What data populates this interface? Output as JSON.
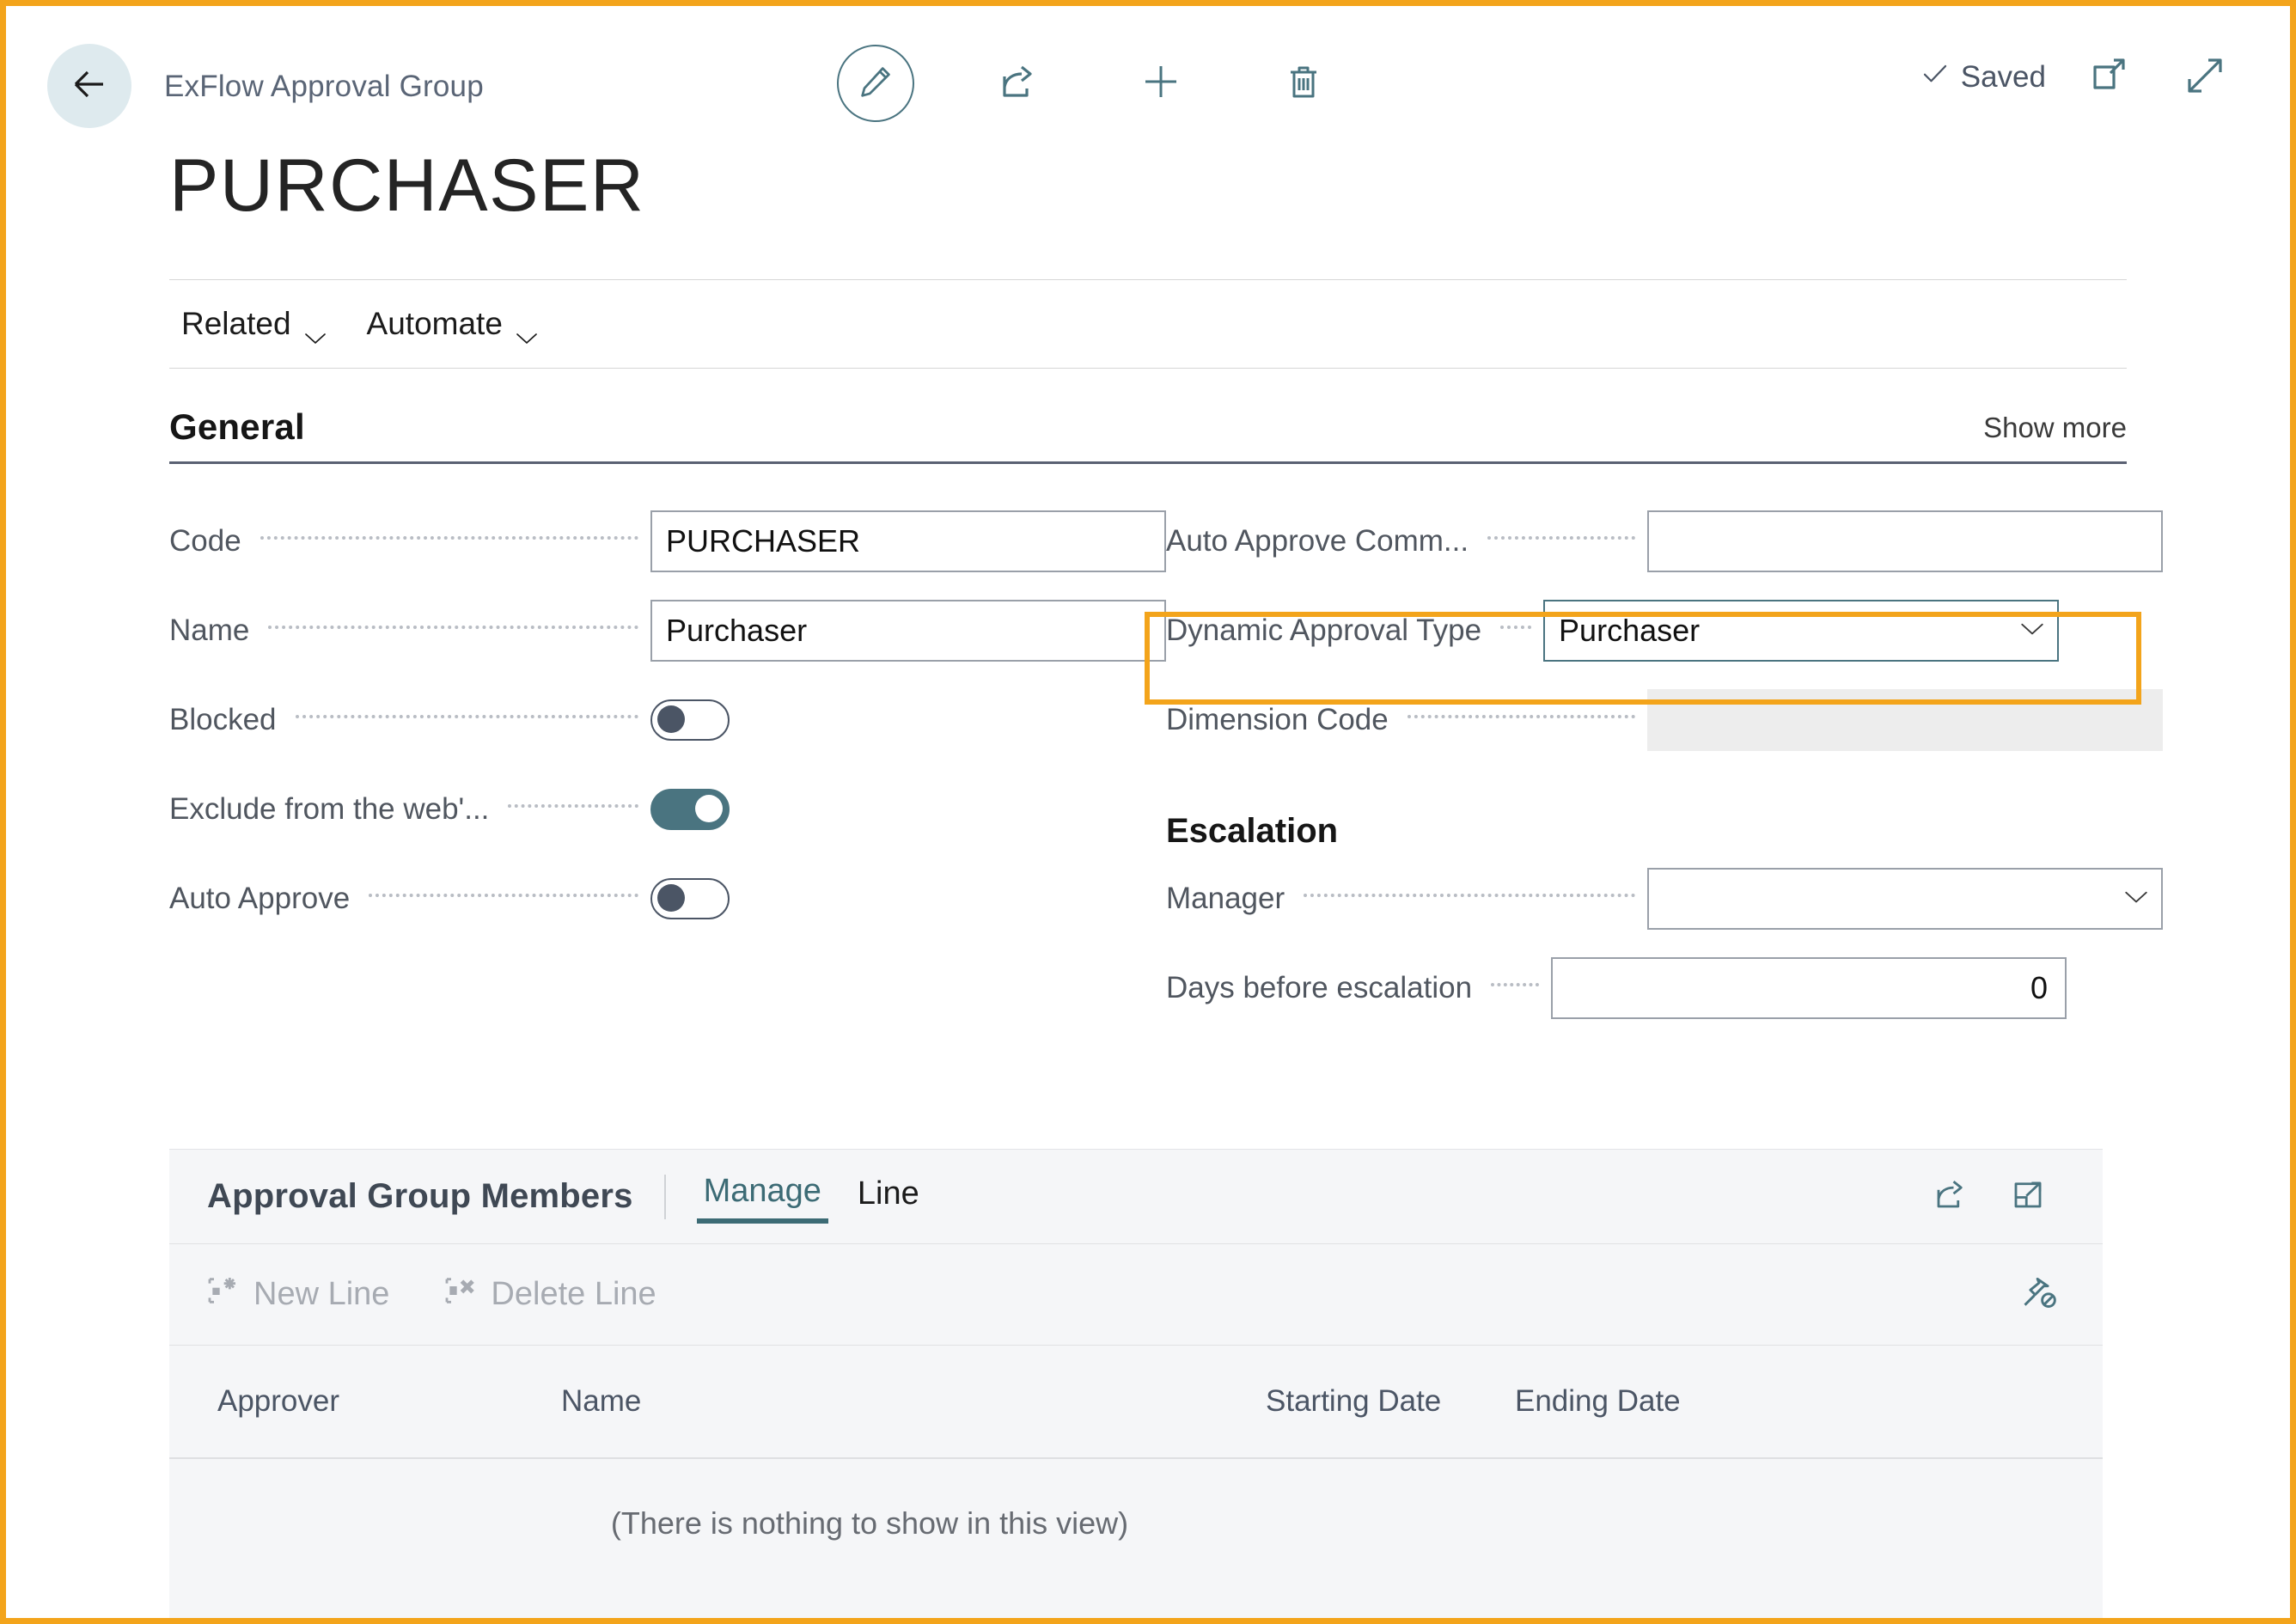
{
  "header": {
    "back_icon": "arrow-left-icon",
    "breadcrumb": "ExFlow Approval Group",
    "actions": [
      {
        "name": "edit-button",
        "icon": "pencil-icon"
      },
      {
        "name": "share-button",
        "icon": "share-icon"
      },
      {
        "name": "new-button",
        "icon": "plus-icon"
      },
      {
        "name": "delete-button",
        "icon": "trash-icon"
      }
    ],
    "saved_label": "Saved",
    "saved_icon": "checkmark-icon",
    "open_new_window_icon": "open-in-new-window-icon",
    "expand_icon": "expand-diagonal-icon"
  },
  "page_title": "PURCHASER",
  "actionbar": {
    "items": [
      {
        "label": "Related",
        "icon": "chevron-down-icon"
      },
      {
        "label": "Automate",
        "icon": "chevron-down-icon"
      }
    ]
  },
  "general": {
    "title": "General",
    "show_more": "Show more",
    "left": {
      "code": {
        "label": "Code",
        "value": "PURCHASER"
      },
      "name": {
        "label": "Name",
        "value": "Purchaser"
      },
      "blocked": {
        "label": "Blocked",
        "value": "off"
      },
      "exclude_web": {
        "label": "Exclude from the web'...",
        "value": "on"
      },
      "auto_approve": {
        "label": "Auto Approve",
        "value": "off"
      }
    },
    "right": {
      "auto_approve_comment": {
        "label": "Auto Approve Comm...",
        "value": ""
      },
      "dynamic_approval_type": {
        "label": "Dynamic Approval Type",
        "value": "Purchaser",
        "icon": "chevron-down-icon"
      },
      "dimension_code": {
        "label": "Dimension Code",
        "value": ""
      },
      "escalation_title": "Escalation",
      "manager": {
        "label": "Manager",
        "value": "",
        "icon": "chevron-down-icon"
      },
      "days_before_escalation": {
        "label": "Days before escalation",
        "value": "0"
      }
    }
  },
  "members": {
    "title": "Approval Group Members",
    "tabs": [
      {
        "label": "Manage",
        "active": true
      },
      {
        "label": "Line",
        "active": false
      }
    ],
    "head_icons": [
      {
        "name": "share-icon"
      },
      {
        "name": "open-in-excel-icon"
      }
    ],
    "toolbar": [
      {
        "label": "New Line",
        "icon": "new-line-icon",
        "disabled": true
      },
      {
        "label": "Delete Line",
        "icon": "delete-line-icon",
        "disabled": true
      }
    ],
    "unpin_icon": "unpin-icon",
    "columns": [
      "Approver",
      "Name",
      "Starting Date",
      "Ending Date"
    ],
    "empty_message": "(There is nothing to show in this view)"
  },
  "colors": {
    "accent_teal": "#4A7480",
    "annotation_orange": "#F3A41B",
    "back_circle": "#DEEAEE",
    "panel_bg": "#F5F6F8"
  }
}
